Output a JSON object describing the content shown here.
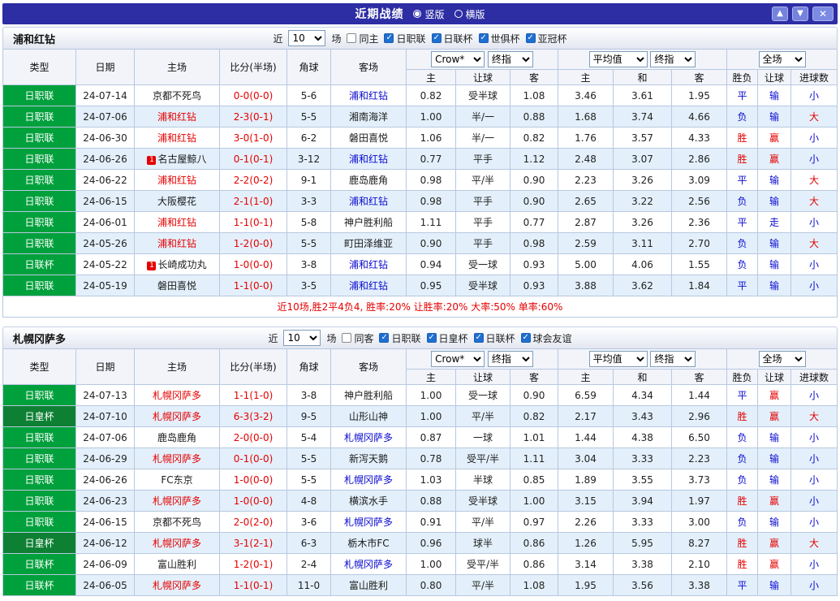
{
  "palette": {
    "red": "#e60000",
    "blue": "#0a0ad0",
    "black": "#1a1a1a",
    "green": "#00a03c",
    "dark_green": "#0e8034",
    "titlebar_navy": "#2d2da4"
  },
  "titlebar": {
    "title": "近期战绩",
    "options": [
      {
        "label": "竖版",
        "selected": true
      },
      {
        "label": "横版",
        "selected": false
      }
    ],
    "buttons": {
      "up": "▲",
      "down": "▼",
      "close": "✕"
    }
  },
  "table_header": {
    "static_cols": [
      "类型",
      "日期",
      "主场",
      "比分(半场)",
      "角球",
      "客场"
    ],
    "odds_selects": [
      "Crow*",
      "终指"
    ],
    "odds_sub": [
      "主",
      "让球",
      "客"
    ],
    "avg_selects": [
      "平均值",
      "终指"
    ],
    "avg_sub": [
      "主",
      "和",
      "客"
    ],
    "scope_select": "全场",
    "result_cols": [
      "胜负",
      "让球",
      "进球数"
    ]
  },
  "sections": [
    {
      "team": "浦和红钻",
      "filter": {
        "near": "近",
        "count": "10",
        "games": "场",
        "same": {
          "label": "同主",
          "checked": false
        },
        "leagues": [
          {
            "label": "日职联",
            "checked": true
          },
          {
            "label": "日联杯",
            "checked": true
          },
          {
            "label": "世俱杯",
            "checked": true
          },
          {
            "label": "亚冠杯",
            "checked": true
          }
        ]
      },
      "summary": "近10场,胜2平4负4, 胜率:20% 让胜率:20% 大率:50% 单率:60%",
      "rows": [
        {
          "type": "日职联",
          "type_color": "green",
          "date": "24-07-14",
          "home": "京都不死鸟",
          "home_color": "black",
          "score": "0-0(0-0)",
          "corner": "5-6",
          "away": "浦和红钻",
          "away_color": "blue",
          "o_home": "0.82",
          "handicap": "受半球",
          "o_away": "1.08",
          "m_home": "3.46",
          "m_draw": "3.61",
          "m_away": "1.95",
          "result": "平",
          "result_color": "blue",
          "let": "输",
          "let_color": "blue",
          "goal": "小",
          "goal_color": "blue"
        },
        {
          "type": "日职联",
          "type_color": "green",
          "date": "24-07-06",
          "home": "浦和红钻",
          "home_color": "red",
          "score": "2-3(0-1)",
          "corner": "5-5",
          "away": "湘南海洋",
          "away_color": "black",
          "o_home": "1.00",
          "handicap": "半/一",
          "o_away": "0.88",
          "m_home": "1.68",
          "m_draw": "3.74",
          "m_away": "4.66",
          "result": "负",
          "result_color": "blue",
          "let": "输",
          "let_color": "blue",
          "goal": "大",
          "goal_color": "red"
        },
        {
          "type": "日职联",
          "type_color": "green",
          "date": "24-06-30",
          "home": "浦和红钻",
          "home_color": "red",
          "score": "3-0(1-0)",
          "corner": "6-2",
          "away": "磐田喜悦",
          "away_color": "black",
          "o_home": "1.06",
          "handicap": "半/一",
          "o_away": "0.82",
          "m_home": "1.76",
          "m_draw": "3.57",
          "m_away": "4.33",
          "result": "胜",
          "result_color": "red",
          "let": "赢",
          "let_color": "red",
          "goal": "小",
          "goal_color": "blue"
        },
        {
          "type": "日职联",
          "type_color": "green",
          "date": "24-06-26",
          "home": "名古屋鲸八",
          "home_color": "black",
          "home_badge": "1",
          "score": "0-1(0-1)",
          "corner": "3-12",
          "away": "浦和红钻",
          "away_color": "blue",
          "o_home": "0.77",
          "handicap": "平手",
          "o_away": "1.12",
          "m_home": "2.48",
          "m_draw": "3.07",
          "m_away": "2.86",
          "result": "胜",
          "result_color": "red",
          "let": "赢",
          "let_color": "red",
          "goal": "小",
          "goal_color": "blue"
        },
        {
          "type": "日职联",
          "type_color": "green",
          "date": "24-06-22",
          "home": "浦和红钻",
          "home_color": "red",
          "score": "2-2(0-2)",
          "corner": "9-1",
          "away": "鹿岛鹿角",
          "away_color": "black",
          "o_home": "0.98",
          "handicap": "平/半",
          "o_away": "0.90",
          "m_home": "2.23",
          "m_draw": "3.26",
          "m_away": "3.09",
          "result": "平",
          "result_color": "blue",
          "let": "输",
          "let_color": "blue",
          "goal": "大",
          "goal_color": "red"
        },
        {
          "type": "日职联",
          "type_color": "green",
          "date": "24-06-15",
          "home": "大阪樱花",
          "home_color": "black",
          "score": "2-1(1-0)",
          "corner": "3-3",
          "away": "浦和红钻",
          "away_color": "blue",
          "o_home": "0.98",
          "handicap": "平手",
          "o_away": "0.90",
          "m_home": "2.65",
          "m_draw": "3.22",
          "m_away": "2.56",
          "result": "负",
          "result_color": "blue",
          "let": "输",
          "let_color": "blue",
          "goal": "大",
          "goal_color": "red"
        },
        {
          "type": "日职联",
          "type_color": "green",
          "date": "24-06-01",
          "home": "浦和红钻",
          "home_color": "red",
          "score": "1-1(0-1)",
          "corner": "5-8",
          "away": "神户胜利船",
          "away_color": "black",
          "o_home": "1.11",
          "handicap": "平手",
          "o_away": "0.77",
          "m_home": "2.87",
          "m_draw": "3.26",
          "m_away": "2.36",
          "result": "平",
          "result_color": "blue",
          "let": "走",
          "let_color": "blue",
          "goal": "小",
          "goal_color": "blue"
        },
        {
          "type": "日职联",
          "type_color": "green",
          "date": "24-05-26",
          "home": "浦和红钻",
          "home_color": "red",
          "score": "1-2(0-0)",
          "corner": "5-5",
          "away": "町田泽维亚",
          "away_color": "black",
          "o_home": "0.90",
          "handicap": "平手",
          "o_away": "0.98",
          "m_home": "2.59",
          "m_draw": "3.11",
          "m_away": "2.70",
          "result": "负",
          "result_color": "blue",
          "let": "输",
          "let_color": "blue",
          "goal": "大",
          "goal_color": "red"
        },
        {
          "type": "日联杯",
          "type_color": "green",
          "date": "24-05-22",
          "home": "长崎成功丸",
          "home_color": "black",
          "home_badge": "1",
          "score": "1-0(0-0)",
          "corner": "3-8",
          "away": "浦和红钻",
          "away_color": "blue",
          "o_home": "0.94",
          "handicap": "受一球",
          "o_away": "0.93",
          "m_home": "5.00",
          "m_draw": "4.06",
          "m_away": "1.55",
          "result": "负",
          "result_color": "blue",
          "let": "输",
          "let_color": "blue",
          "goal": "小",
          "goal_color": "blue"
        },
        {
          "type": "日职联",
          "type_color": "green",
          "date": "24-05-19",
          "home": "磐田喜悦",
          "home_color": "black",
          "score": "1-1(0-0)",
          "corner": "3-5",
          "away": "浦和红钻",
          "away_color": "blue",
          "o_home": "0.95",
          "handicap": "受半球",
          "o_away": "0.93",
          "m_home": "3.88",
          "m_draw": "3.62",
          "m_away": "1.84",
          "result": "平",
          "result_color": "blue",
          "let": "输",
          "let_color": "blue",
          "goal": "小",
          "goal_color": "blue"
        }
      ]
    },
    {
      "team": "札幌冈萨多",
      "filter": {
        "near": "近",
        "count": "10",
        "games": "场",
        "same": {
          "label": "同客",
          "checked": false
        },
        "leagues": [
          {
            "label": "日职联",
            "checked": true
          },
          {
            "label": "日皇杯",
            "checked": true
          },
          {
            "label": "日联杯",
            "checked": true
          },
          {
            "label": "球会友谊",
            "checked": true
          }
        ]
      },
      "summary": null,
      "rows": [
        {
          "type": "日职联",
          "type_color": "green",
          "date": "24-07-13",
          "home": "札幌冈萨多",
          "home_color": "red",
          "score": "1-1(1-0)",
          "corner": "3-8",
          "away": "神户胜利船",
          "away_color": "black",
          "o_home": "1.00",
          "handicap": "受一球",
          "o_away": "0.90",
          "m_home": "6.59",
          "m_draw": "4.34",
          "m_away": "1.44",
          "result": "平",
          "result_color": "blue",
          "let": "赢",
          "let_color": "red",
          "goal": "小",
          "goal_color": "blue"
        },
        {
          "type": "日皇杯",
          "type_color": "dark_green",
          "date": "24-07-10",
          "home": "札幌冈萨多",
          "home_color": "red",
          "score": "6-3(3-2)",
          "corner": "9-5",
          "away": "山形山神",
          "away_color": "black",
          "o_home": "1.00",
          "handicap": "平/半",
          "o_away": "0.82",
          "m_home": "2.17",
          "m_draw": "3.43",
          "m_away": "2.96",
          "result": "胜",
          "result_color": "red",
          "let": "赢",
          "let_color": "red",
          "goal": "大",
          "goal_color": "red"
        },
        {
          "type": "日职联",
          "type_color": "green",
          "date": "24-07-06",
          "home": "鹿岛鹿角",
          "home_color": "black",
          "score": "2-0(0-0)",
          "corner": "5-4",
          "away": "札幌冈萨多",
          "away_color": "blue",
          "o_home": "0.87",
          "handicap": "一球",
          "o_away": "1.01",
          "m_home": "1.44",
          "m_draw": "4.38",
          "m_away": "6.50",
          "result": "负",
          "result_color": "blue",
          "let": "输",
          "let_color": "blue",
          "goal": "小",
          "goal_color": "blue"
        },
        {
          "type": "日职联",
          "type_color": "green",
          "date": "24-06-29",
          "home": "札幌冈萨多",
          "home_color": "red",
          "score": "0-1(0-0)",
          "corner": "5-5",
          "away": "新泻天鹅",
          "away_color": "black",
          "o_home": "0.78",
          "handicap": "受平/半",
          "o_away": "1.11",
          "m_home": "3.04",
          "m_draw": "3.33",
          "m_away": "2.23",
          "result": "负",
          "result_color": "blue",
          "let": "输",
          "let_color": "blue",
          "goal": "小",
          "goal_color": "blue"
        },
        {
          "type": "日职联",
          "type_color": "green",
          "date": "24-06-26",
          "home": "FC东京",
          "home_color": "black",
          "score": "1-0(0-0)",
          "corner": "5-5",
          "away": "札幌冈萨多",
          "away_color": "blue",
          "o_home": "1.03",
          "handicap": "半球",
          "o_away": "0.85",
          "m_home": "1.89",
          "m_draw": "3.55",
          "m_away": "3.73",
          "result": "负",
          "result_color": "blue",
          "let": "输",
          "let_color": "blue",
          "goal": "小",
          "goal_color": "blue"
        },
        {
          "type": "日职联",
          "type_color": "green",
          "date": "24-06-23",
          "home": "札幌冈萨多",
          "home_color": "red",
          "score": "1-0(0-0)",
          "corner": "4-8",
          "away": "横滨水手",
          "away_color": "black",
          "o_home": "0.88",
          "handicap": "受半球",
          "o_away": "1.00",
          "m_home": "3.15",
          "m_draw": "3.94",
          "m_away": "1.97",
          "result": "胜",
          "result_color": "red",
          "let": "赢",
          "let_color": "red",
          "goal": "小",
          "goal_color": "blue"
        },
        {
          "type": "日职联",
          "type_color": "green",
          "date": "24-06-15",
          "home": "京都不死鸟",
          "home_color": "black",
          "score": "2-0(2-0)",
          "corner": "3-6",
          "away": "札幌冈萨多",
          "away_color": "blue",
          "o_home": "0.91",
          "handicap": "平/半",
          "o_away": "0.97",
          "m_home": "2.26",
          "m_draw": "3.33",
          "m_away": "3.00",
          "result": "负",
          "result_color": "blue",
          "let": "输",
          "let_color": "blue",
          "goal": "小",
          "goal_color": "blue"
        },
        {
          "type": "日皇杯",
          "type_color": "dark_green",
          "date": "24-06-12",
          "home": "札幌冈萨多",
          "home_color": "red",
          "score": "3-1(2-1)",
          "corner": "6-3",
          "away": "栃木市FC",
          "away_color": "black",
          "o_home": "0.96",
          "handicap": "球半",
          "o_away": "0.86",
          "m_home": "1.26",
          "m_draw": "5.95",
          "m_away": "8.27",
          "result": "胜",
          "result_color": "red",
          "let": "赢",
          "let_color": "red",
          "goal": "大",
          "goal_color": "red"
        },
        {
          "type": "日联杯",
          "type_color": "green",
          "date": "24-06-09",
          "home": "富山胜利",
          "home_color": "black",
          "score": "1-2(0-1)",
          "corner": "2-4",
          "away": "札幌冈萨多",
          "away_color": "blue",
          "o_home": "1.00",
          "handicap": "受平/半",
          "o_away": "0.86",
          "m_home": "3.14",
          "m_draw": "3.38",
          "m_away": "2.10",
          "result": "胜",
          "result_color": "red",
          "let": "赢",
          "let_color": "red",
          "goal": "小",
          "goal_color": "blue"
        },
        {
          "type": "日联杯",
          "type_color": "green",
          "date": "24-06-05",
          "home": "札幌冈萨多",
          "home_color": "red",
          "score": "1-1(0-1)",
          "corner": "11-0",
          "away": "富山胜利",
          "away_color": "black",
          "o_home": "0.80",
          "handicap": "平/半",
          "o_away": "1.08",
          "m_home": "1.95",
          "m_draw": "3.56",
          "m_away": "3.38",
          "result": "平",
          "result_color": "blue",
          "let": "输",
          "let_color": "blue",
          "goal": "小",
          "goal_color": "blue"
        }
      ]
    }
  ]
}
